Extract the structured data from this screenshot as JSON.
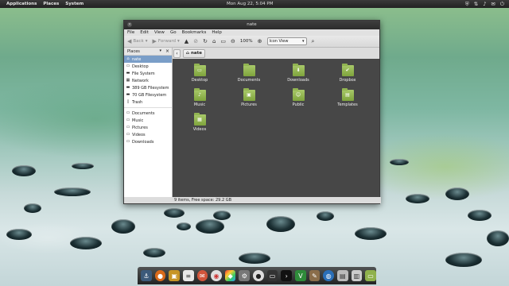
{
  "top_panel": {
    "menus": [
      "Applications",
      "Places",
      "System"
    ],
    "clock": "Mon Aug 22,  5:04 PM",
    "tray_icons": [
      "shield-icon",
      "network-icon",
      "volume-icon",
      "mail-icon",
      "power-icon"
    ]
  },
  "window": {
    "title": "nate",
    "menu": [
      "File",
      "Edit",
      "View",
      "Go",
      "Bookmarks",
      "Help"
    ],
    "toolbar": {
      "back": "Back",
      "forward": "Forward",
      "zoom": "100%",
      "view_mode": "Icon View"
    },
    "sidebar": {
      "header": "Places",
      "places": [
        "nate",
        "Desktop",
        "File System",
        "Network",
        "389 GB Filesystem",
        "70 GB Filesystem",
        "Trash"
      ],
      "bookmarks": [
        "Documents",
        "Music",
        "Pictures",
        "Videos",
        "Downloads"
      ]
    },
    "path": {
      "crumb": "nate"
    },
    "items": [
      {
        "label": "Desktop",
        "emblem": "▭"
      },
      {
        "label": "Documents",
        "emblem": ""
      },
      {
        "label": "Downloads",
        "emblem": "⬇"
      },
      {
        "label": "Dropbox",
        "emblem": "✔"
      },
      {
        "label": "Music",
        "emblem": "♪"
      },
      {
        "label": "Pictures",
        "emblem": "▣"
      },
      {
        "label": "Public",
        "emblem": "☺"
      },
      {
        "label": "Templates",
        "emblem": "▤"
      },
      {
        "label": "Videos",
        "emblem": "▦"
      }
    ],
    "status": "9 items, Free space: 29.2 GB"
  },
  "dock": {
    "apps": [
      "anchor-icon",
      "firefox-icon",
      "image-viewer-icon",
      "text-editor-icon",
      "pidgin-icon",
      "chrome-icon",
      "color-icon",
      "settings-icon",
      "inkscape-icon",
      "monitor-icon",
      "terminal-icon",
      "vim-icon",
      "gimp-icon",
      "globe-icon",
      "files-icon",
      "files2-icon",
      "folder-icon"
    ]
  },
  "colors": {
    "content_bg": "#474747",
    "folder_green": "#8fb14c",
    "selection": "#7a9ec8"
  }
}
